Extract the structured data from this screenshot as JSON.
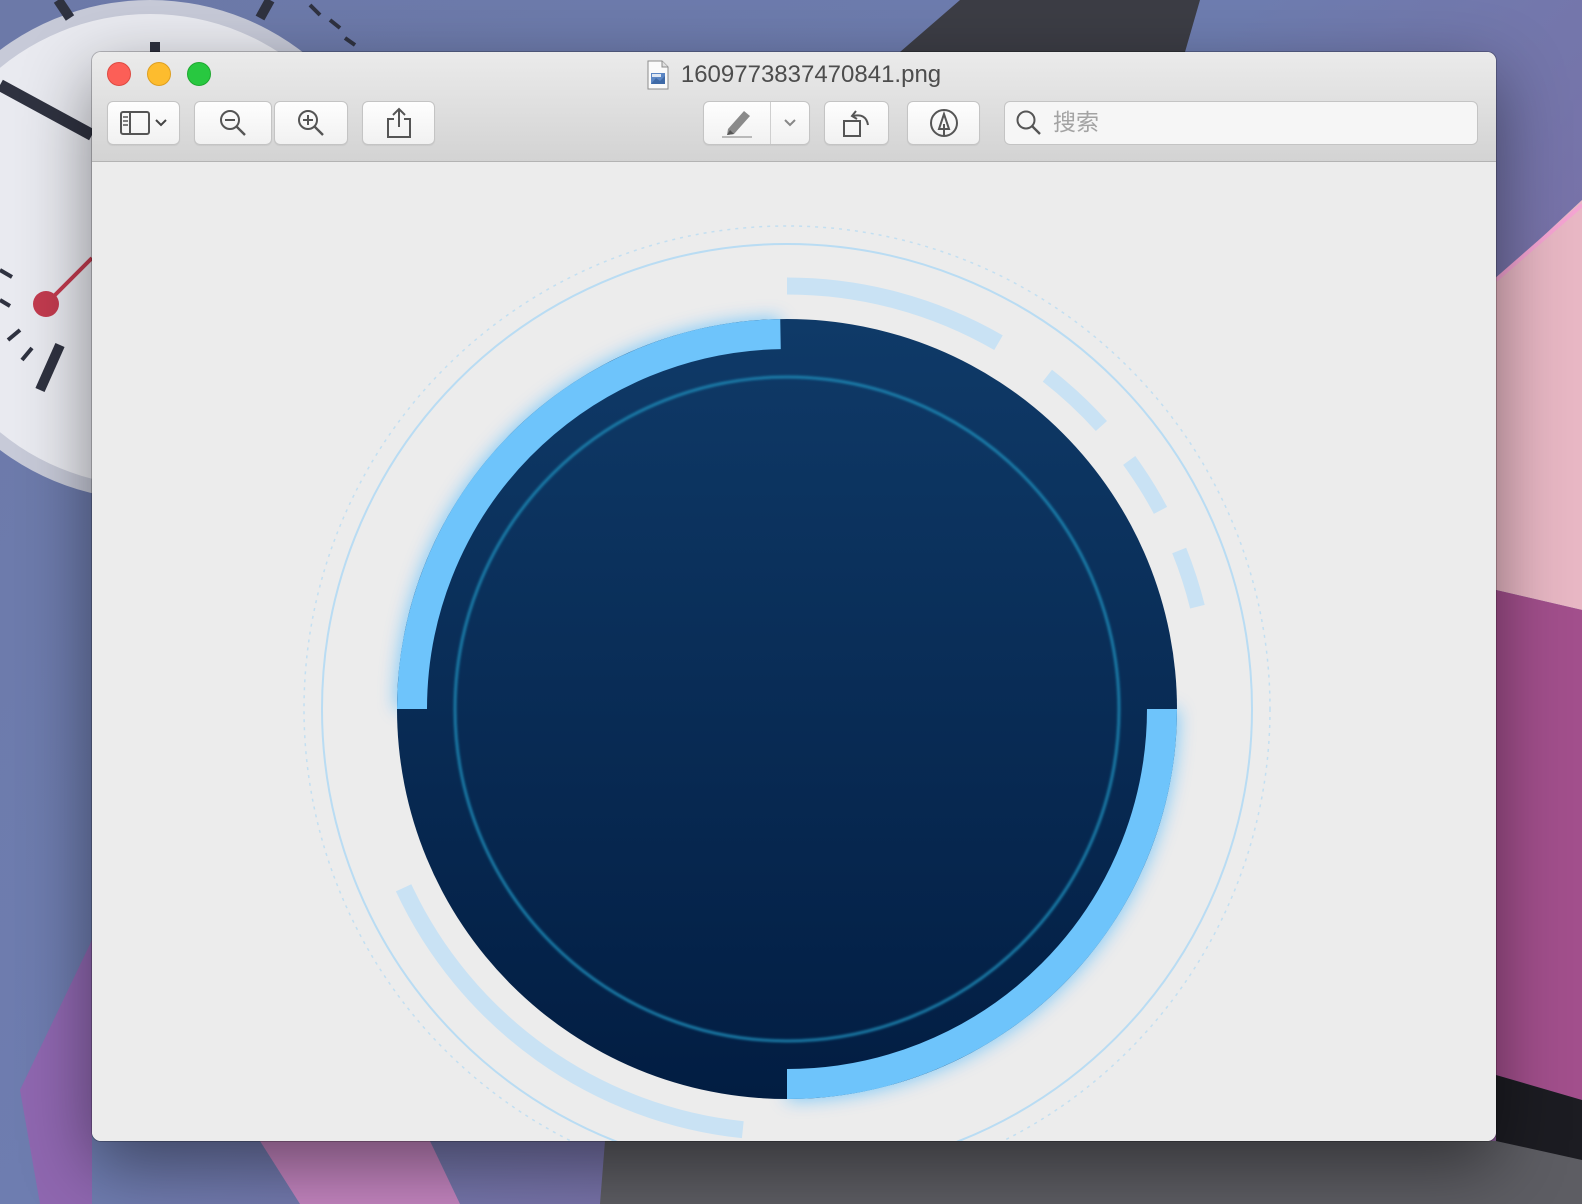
{
  "window": {
    "title": "1609773837470841.png",
    "file_icon": "png-document-icon"
  },
  "toolbar": {
    "sidebar_button": {
      "icon": "sidebar-icon",
      "dropdown_icon": "chevron-down-icon"
    },
    "zoom_out_button": {
      "icon": "zoom-out-icon"
    },
    "zoom_in_button": {
      "icon": "zoom-in-icon"
    },
    "share_button": {
      "icon": "share-icon"
    },
    "highlight_button": {
      "icon": "highlighter-icon",
      "dropdown_icon": "chevron-down-icon"
    },
    "rotate_button": {
      "icon": "rotate-left-icon"
    },
    "markup_button": {
      "icon": "markup-pen-icon"
    },
    "search": {
      "placeholder": "搜索",
      "value": "",
      "icon": "search-icon"
    }
  },
  "image_content": {
    "description_icons": "circular-hud-frame",
    "colors": {
      "disc_top": "#0f3a68",
      "disc_bottom": "#021d42",
      "bright_arc": "#6ec4fb",
      "pale_arc": "#c9e2f4",
      "inner_ring": "#1d89b6",
      "outer_ring": "#b9dcf3",
      "canvas_bg": "#ececec"
    }
  }
}
